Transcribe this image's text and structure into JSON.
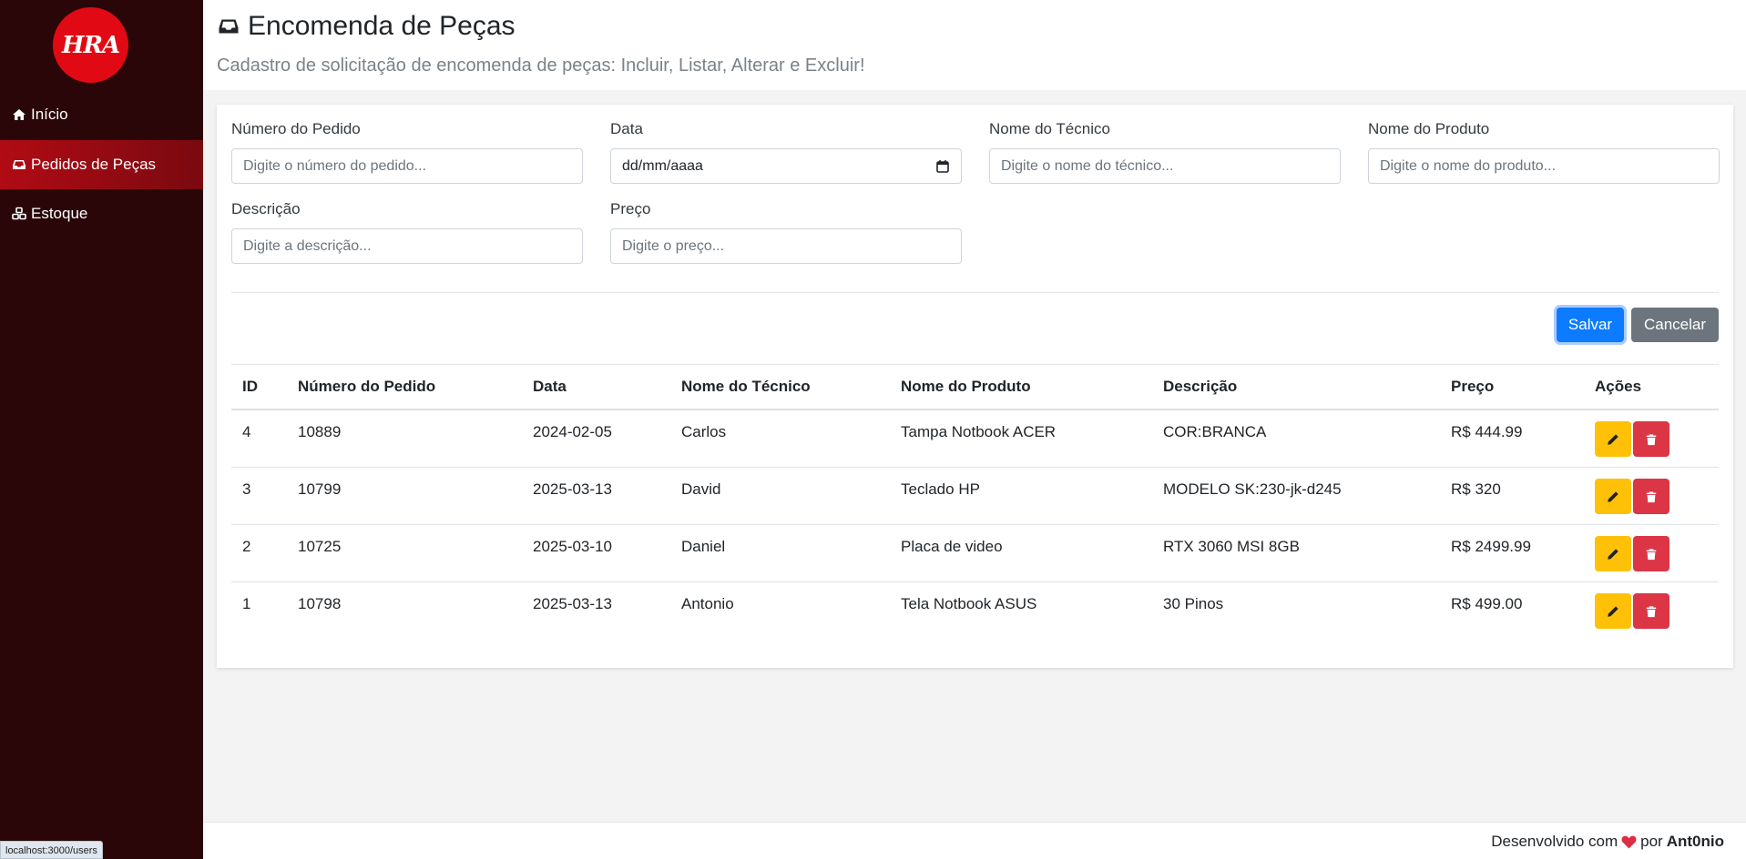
{
  "brand": {
    "logo_text": "HRA",
    "accent": "#e10a14",
    "sidebar_bg": "#2a0608"
  },
  "sidebar": {
    "items": [
      {
        "label": "Início",
        "icon": "home-icon",
        "active": false
      },
      {
        "label": "Pedidos de Peças",
        "icon": "inbox-icon",
        "active": true
      },
      {
        "label": "Estoque",
        "icon": "cubes-icon",
        "active": false
      }
    ]
  },
  "status_url": "localhost:3000/users",
  "header": {
    "title": "Encomenda de Peças",
    "subtitle": "Cadastro de solicitação de encomenda de peças: Incluir, Listar, Alterar e Excluir!"
  },
  "form": {
    "numero": {
      "label": "Número do Pedido",
      "placeholder": "Digite o número do pedido..."
    },
    "data": {
      "label": "Data",
      "value": "dd/mm/aaaa"
    },
    "tecnico": {
      "label": "Nome do Técnico",
      "placeholder": "Digite o nome do técnico..."
    },
    "produto": {
      "label": "Nome do Produto",
      "placeholder": "Digite o nome do produto..."
    },
    "descricao": {
      "label": "Descrição",
      "placeholder": "Digite a descrição..."
    },
    "preco": {
      "label": "Preço",
      "placeholder": "Digite o preço..."
    },
    "save_label": "Salvar",
    "cancel_label": "Cancelar"
  },
  "table": {
    "headers": [
      "ID",
      "Número do Pedido",
      "Data",
      "Nome do Técnico",
      "Nome do Produto",
      "Descrição",
      "Preço",
      "Ações"
    ],
    "rows": [
      [
        "4",
        "10889",
        "2024-02-05",
        "Carlos",
        "Tampa Notbook ACER",
        "COR:BRANCA",
        "R$ 444.99"
      ],
      [
        "3",
        "10799",
        "2025-03-13",
        "David",
        "Teclado HP",
        "MODELO SK:230-jk-d245",
        "R$ 320"
      ],
      [
        "2",
        "10725",
        "2025-03-10",
        "Daniel",
        "Placa de video",
        "RTX 3060 MSI 8GB",
        "R$ 2499.99"
      ],
      [
        "1",
        "10798",
        "2025-03-13",
        "Antonio",
        "Tela Notbook ASUS",
        "30 Pinos",
        "R$ 499.00"
      ]
    ]
  },
  "footer": {
    "text": "Desenvolvido com",
    "by": "por",
    "author": "Ant0nio"
  }
}
